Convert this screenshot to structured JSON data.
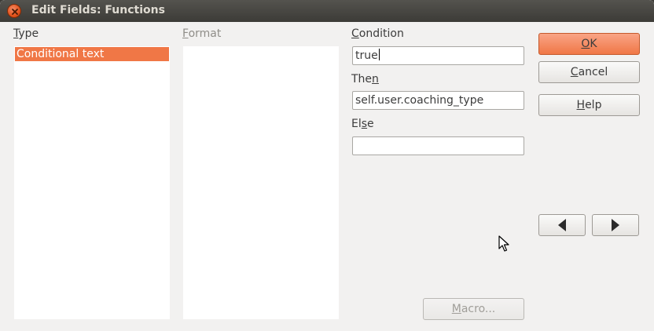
{
  "window": {
    "title": "Edit Fields: Functions"
  },
  "type_section": {
    "label_first": "T",
    "label_rest": "ype",
    "items": [
      "Conditional text"
    ]
  },
  "format_section": {
    "label_first": "F",
    "label_rest": "ormat"
  },
  "condition": {
    "label_first": "C",
    "label_rest": "ondition",
    "value": "true"
  },
  "then": {
    "label_start": "The",
    "label_accel": "n",
    "value": "self.user.coaching_type"
  },
  "else": {
    "label_start": "El",
    "label_accel": "s",
    "label_end": "e",
    "value": ""
  },
  "buttons": {
    "ok_accel": "O",
    "ok_rest": "K",
    "cancel_accel": "C",
    "cancel_rest": "ancel",
    "help_accel": "H",
    "help_rest": "elp",
    "macro_accel": "M",
    "macro_rest": "acro..."
  },
  "icons": {
    "close": "close-icon",
    "prev": "arrow-left-icon",
    "next": "arrow-right-icon",
    "pointer": "mouse-pointer-icon"
  },
  "colors": {
    "accent": "#f07746",
    "titlebar": "#3c3b37",
    "background": "#f2f1f0"
  }
}
